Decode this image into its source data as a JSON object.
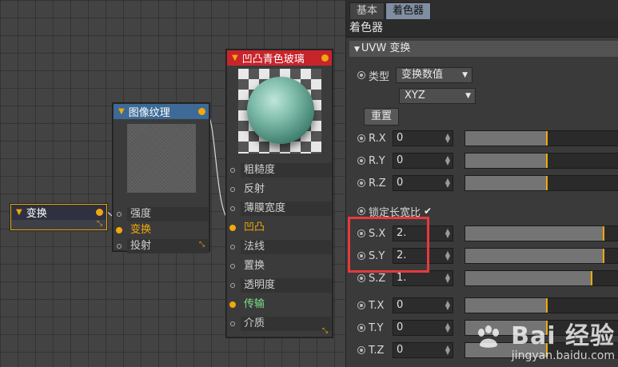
{
  "nodes": {
    "transform": {
      "title": "变换"
    },
    "image_texture": {
      "title": "图像纹理",
      "ports": [
        "强度",
        "变换",
        "投射"
      ]
    },
    "material": {
      "title": "凹凸青色玻璃",
      "ports": [
        "粗糙度",
        "反射",
        "薄膜宽度",
        "凹凸",
        "法线",
        "置换",
        "透明度",
        "传输",
        "介质"
      ]
    }
  },
  "panel": {
    "tabs": [
      "基本",
      "着色器"
    ],
    "section_title": "着色器",
    "sub_header": "UVW 变换",
    "type_label": "类型",
    "type_value": "变换数值",
    "order_value": "XYZ",
    "reset_label": "重置",
    "lock_label": "锁定长宽比",
    "params": [
      {
        "label": "R.X",
        "value": "0",
        "level": 0.53
      },
      {
        "label": "R.Y",
        "value": "0",
        "level": 0.53
      },
      {
        "label": "R.Z",
        "value": "0",
        "level": 0.53
      },
      {
        "label": "S.X",
        "value": "2.",
        "level": 0.9
      },
      {
        "label": "S.Y",
        "value": "2.",
        "level": 0.9
      },
      {
        "label": "S.Z",
        "value": "1.",
        "level": 0.82
      },
      {
        "label": "T.X",
        "value": "0",
        "level": 0.53
      },
      {
        "label": "T.Y",
        "value": "0",
        "level": 0.53
      },
      {
        "label": "T.Z",
        "value": "0",
        "level": 0.53
      }
    ]
  },
  "watermark": {
    "logo": "Bai 经验",
    "url": "jingyan.baidu.com"
  },
  "colors": {
    "accent": "#f0a80c",
    "highlight": "#e53a3a",
    "material_header": "#c8242b",
    "texture_header": "#3d6a96"
  }
}
